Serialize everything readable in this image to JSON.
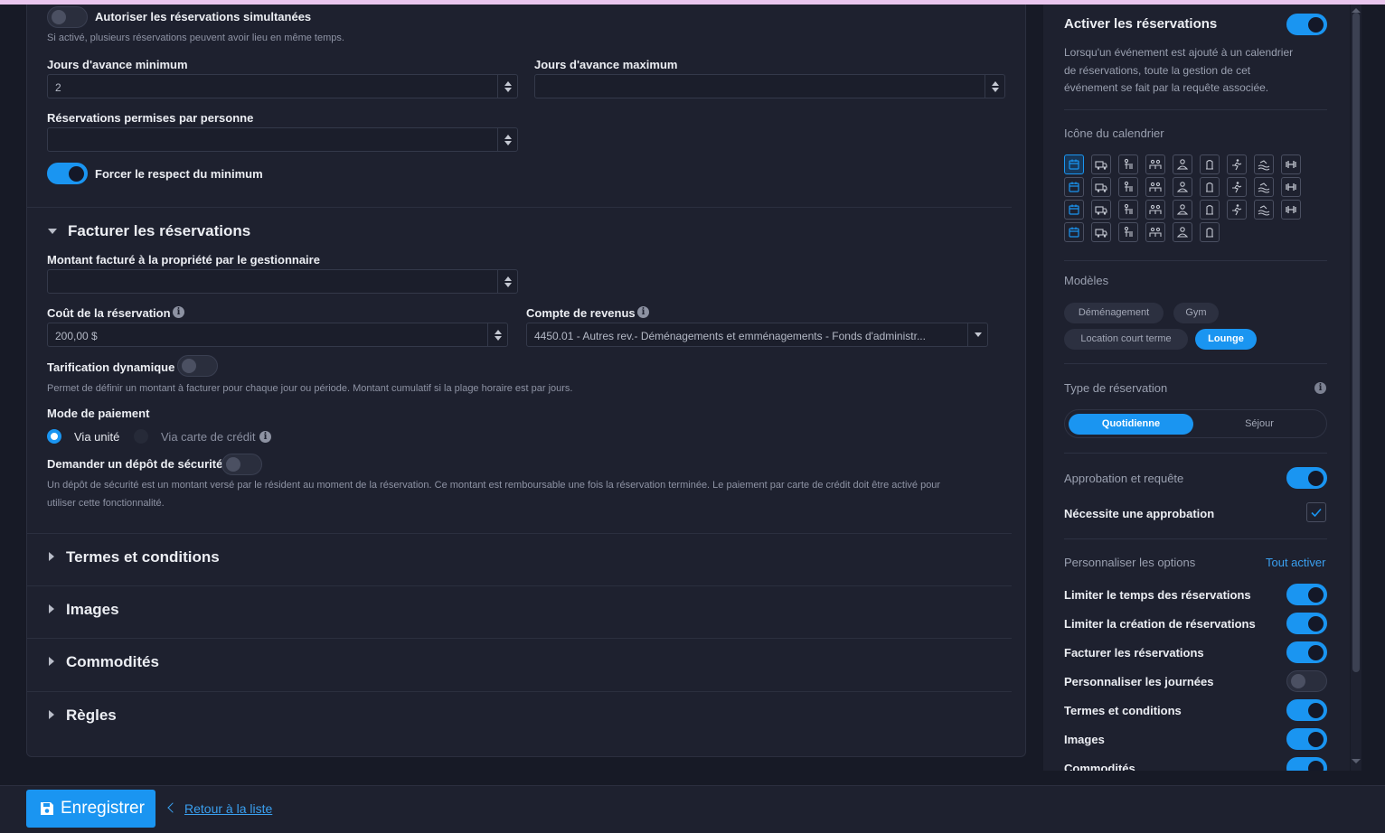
{
  "main": {
    "simultaneous": {
      "label": "Autoriser les réservations simultanées",
      "help": "Si activé, plusieurs réservations peuvent avoir lieu en même temps.",
      "on": false
    },
    "min_days": {
      "label": "Jours d'avance minimum",
      "value": "2"
    },
    "max_days": {
      "label": "Jours d'avance maximum",
      "value": ""
    },
    "per_person": {
      "label": "Réservations permises par personne",
      "value": ""
    },
    "force_min": {
      "label": "Forcer le respect du minimum",
      "on": true
    },
    "billing_section": {
      "title": "Facturer les réservations",
      "expanded": true
    },
    "manager_amount": {
      "label": "Montant facturé à la propriété par le gestionnaire",
      "value": ""
    },
    "cost": {
      "label": "Coût de la réservation",
      "value": "200,00 $"
    },
    "revenue_account": {
      "label": "Compte de revenus",
      "value": "4450.01 - Autres rev.- Déménagements et emménagements - Fonds d'administr..."
    },
    "dynamic_pricing": {
      "label": "Tarification dynamique",
      "help": "Permet de définir un montant à facturer pour chaque jour ou période. Montant cumulatif si la plage horaire est par jours.",
      "on": false
    },
    "payment_mode": {
      "label": "Mode de paiement",
      "options": [
        "Via unité",
        "Via carte de crédit"
      ],
      "selected": "Via unité"
    },
    "deposit": {
      "label": "Demander un dépôt de sécurité",
      "help_line1": "Un dépôt de sécurité est un montant versé par le résident au moment de la réservation. Ce montant est remboursable une fois la réservation terminée. Le paiement par carte de crédit doit être activé pour",
      "help_line2": "utiliser cette fonctionnalité.",
      "on": false
    },
    "collapsed_sections": [
      "Termes et conditions",
      "Images",
      "Commodités",
      "Règles"
    ]
  },
  "right": {
    "activate": {
      "title": "Activer les réservations",
      "desc_lines": [
        "Lorsqu'un événement est ajouté à un calendrier",
        "de réservations, toute la gestion de cet",
        "événement se fait par la requête associée."
      ],
      "on": true
    },
    "calendar_icon": {
      "title": "Icône du calendrier",
      "selected_index": 0
    },
    "models": {
      "title": "Modèles",
      "items": [
        "Déménagement",
        "Gym",
        "Location court terme",
        "Lounge"
      ],
      "active": "Lounge"
    },
    "reservation_type": {
      "title": "Type de réservation",
      "options": [
        "Quotidienne",
        "Séjour"
      ],
      "active": "Quotidienne"
    },
    "approval": {
      "title": "Approbation et requête",
      "on": true,
      "needs_label": "Nécessite une approbation",
      "needs_checked": true
    },
    "customize": {
      "title": "Personnaliser les options",
      "all_label": "Tout activer",
      "options": [
        {
          "label": "Limiter le temps des réservations",
          "on": true
        },
        {
          "label": "Limiter la création de réservations",
          "on": true
        },
        {
          "label": "Facturer les réservations",
          "on": true
        },
        {
          "label": "Personnaliser les journées",
          "on": false
        },
        {
          "label": "Termes et conditions",
          "on": true
        },
        {
          "label": "Images",
          "on": true
        },
        {
          "label": "Commodités",
          "on": true
        }
      ]
    }
  },
  "footer": {
    "save_label": "Enregistrer",
    "back_label": "Retour à la liste"
  },
  "colors": {
    "accent": "#1a95f1",
    "background": "#171a26",
    "panel": "#1e212f"
  }
}
